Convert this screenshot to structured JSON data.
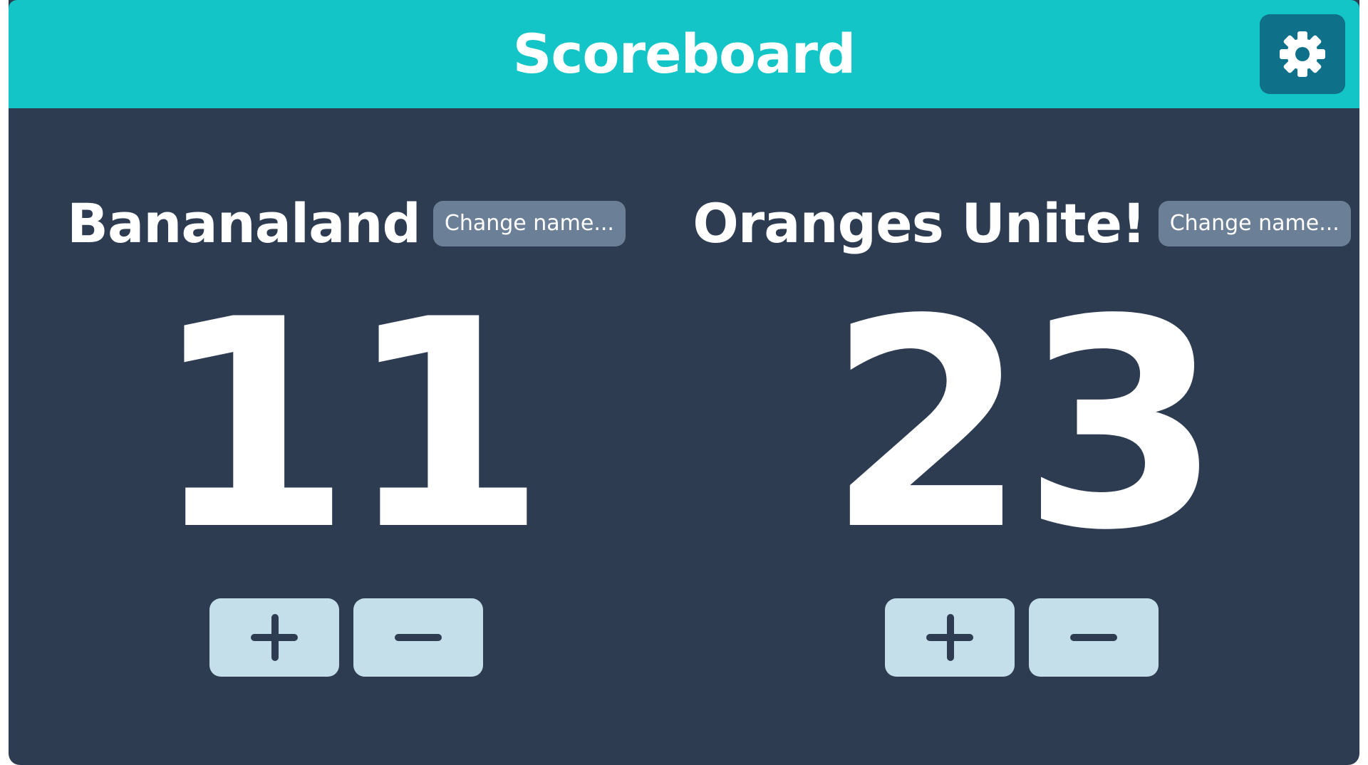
{
  "header": {
    "title": "Scoreboard",
    "settings_icon": "gear-icon"
  },
  "teams": [
    {
      "name": "Bananaland",
      "change_name_label": "Change name...",
      "score": "11",
      "increment_icon": "plus-icon",
      "decrement_icon": "minus-icon"
    },
    {
      "name": "Oranges Unite!",
      "change_name_label": "Change name...",
      "score": "23",
      "increment_icon": "plus-icon",
      "decrement_icon": "minus-icon"
    }
  ],
  "colors": {
    "header_bg": "#13c5c7",
    "body_bg": "#2d3c51",
    "settings_bg": "#0e7189",
    "change_name_bg": "#6b7f96",
    "control_bg": "#c4dfea",
    "control_icon": "#2d3c51"
  }
}
